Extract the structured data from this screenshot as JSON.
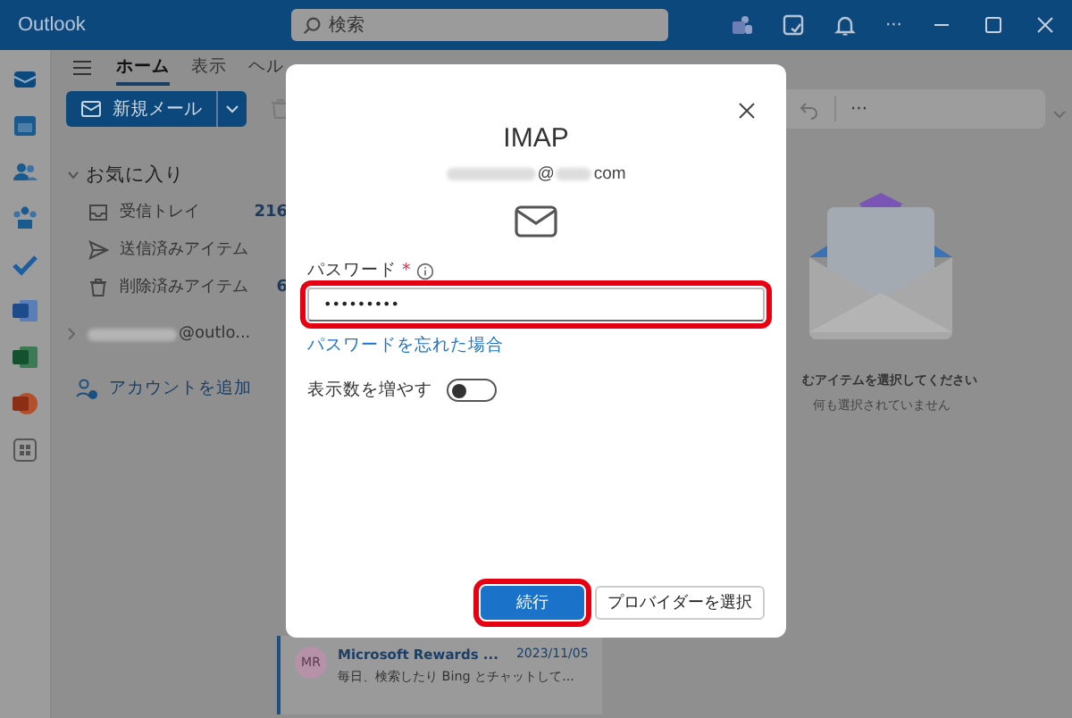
{
  "app": {
    "name": "Outlook"
  },
  "search": {
    "placeholder": "検索"
  },
  "title_more": "···",
  "ribbon_tabs": [
    {
      "label": "ホーム",
      "selected": true
    },
    {
      "label": "表示",
      "selected": false
    },
    {
      "label": "ヘル",
      "selected": false
    }
  ],
  "new_mail": {
    "label": "新規メール"
  },
  "toolbar_more": "···",
  "favorites": {
    "label": "お気に入り",
    "expanded": true,
    "items": [
      {
        "kind": "inbox",
        "label": "受信トレイ",
        "count": "216"
      },
      {
        "kind": "sent",
        "label": "送信済みアイテム"
      },
      {
        "kind": "deleted",
        "label": "削除済みアイテム",
        "count": "6"
      }
    ]
  },
  "account": {
    "label": "@outlo...",
    "expanded": false
  },
  "add_account": "アカウントを追加",
  "message": {
    "avatar": "MR",
    "sender": "Microsoft Rewards ...",
    "date": "2023/11/05",
    "preview": "毎日、検索したり Bing とチャットして..."
  },
  "reading_pane": {
    "title": "むアイテムを選択してください",
    "subtitle": "何も選択されていません"
  },
  "dialog": {
    "title": "IMAP",
    "email_at": "@",
    "email_domain": "com",
    "password": {
      "label": "パスワード",
      "required_mark": "*",
      "value": "•••••••••",
      "highlighted": true
    },
    "forgot_link": "パスワードを忘れた場合",
    "toggle": {
      "label": "表示数を増やす",
      "on": false
    },
    "buttons": [
      {
        "label": "続行",
        "kind": "primary",
        "highlighted": true
      },
      {
        "label": "プロバイダーを選択",
        "kind": "secondary",
        "highlighted": false
      }
    ]
  }
}
